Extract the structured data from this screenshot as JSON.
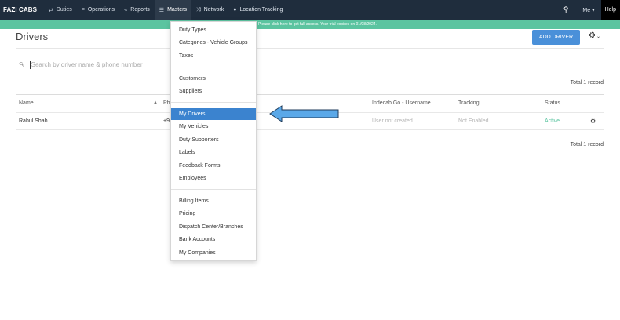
{
  "nav": {
    "brand": "FAZI CABS",
    "items": [
      {
        "label": "Duties",
        "icon": "⇄",
        "icon_name": "exchange-icon"
      },
      {
        "label": "Operations",
        "icon": "≡",
        "icon_name": "list-icon"
      },
      {
        "label": "Reports",
        "icon": "📈",
        "icon_name": "chart-icon"
      },
      {
        "label": "Masters",
        "icon": "☰",
        "icon_name": "stack-icon"
      },
      {
        "label": "Network",
        "icon": "⤨",
        "icon_name": "network-icon"
      },
      {
        "label": "Location Tracking",
        "icon": "📍",
        "icon_name": "location-pin-icon"
      }
    ],
    "me_label": "Me ▾",
    "help_label": "Help"
  },
  "banner": {
    "text": "verified. Please click here to get full access. Your trial expires on 01/08/2024."
  },
  "page": {
    "title": "Drivers",
    "add_button": "ADD DRIVER"
  },
  "search": {
    "placeholder": "Search by driver name & phone number",
    "value": ""
  },
  "totals": {
    "top": "Total 1 record",
    "bottom": "Total 1 record"
  },
  "table": {
    "columns": [
      "Name",
      "Ph",
      "Indecab Go - Username",
      "Tracking",
      "Status"
    ],
    "rows": [
      {
        "name": "Rahul Shah",
        "phone": "+9",
        "username": "User not created",
        "tracking": "Not Enabled",
        "status": "Active"
      }
    ]
  },
  "dropdown": {
    "groups": [
      [
        "Duty Types",
        "Categories - Vehicle Groups",
        "Taxes"
      ],
      [
        "Customers",
        "Suppliers"
      ],
      [
        "My Drivers",
        "My Vehicles",
        "Duty Supporters",
        "Labels",
        "Feedback Forms",
        "Employees"
      ],
      [
        "Billing Items",
        "Pricing",
        "Dispatch Center/Branches",
        "Bank Accounts",
        "My Companies"
      ]
    ],
    "selected": "My Drivers"
  },
  "colors": {
    "nav_bg": "#1f2d3d",
    "banner_bg": "#5bc4a0",
    "accent": "#4a90d9",
    "selected_item": "#3b83cf",
    "active_status": "#5bc4a0"
  }
}
